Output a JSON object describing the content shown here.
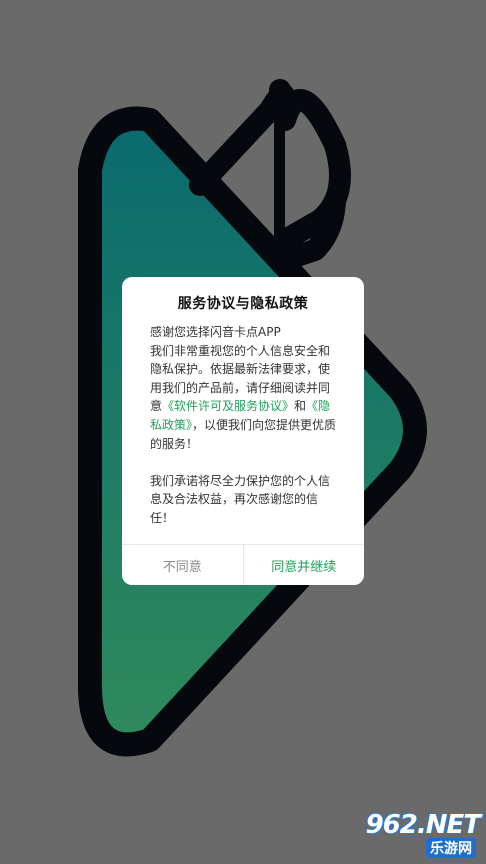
{
  "dialog": {
    "title": "服务协议与隐私政策",
    "line1": "感谢您选择闪音卡点APP",
    "para1_a": "我们非常重视您的个人信息安全和隐私保护。依据最新法律要求，使用我们的产品前，请仔细阅读并同意",
    "link_license": "《软件许可及服务协议》",
    "para1_and": "和",
    "link_privacy": "《隐私政策》",
    "para1_b": "，以便我们向您提供更优质的服务！",
    "para2": "我们承诺将尽全力保护您的个人信息及合法权益，再次感谢您的信任！",
    "disagree_label": "不同意",
    "agree_label": "同意并继续"
  },
  "watermark": {
    "top": "962.NET",
    "bottom": "乐游网"
  },
  "colors": {
    "accent": "#1fa35a",
    "overlay": "#6a6a6a",
    "logo_outline": "#05080c",
    "logo_fill_top": "#0d6b6b",
    "logo_fill_bottom": "#2f8a5a"
  },
  "icons": {
    "splash": "app-logo-icon"
  }
}
